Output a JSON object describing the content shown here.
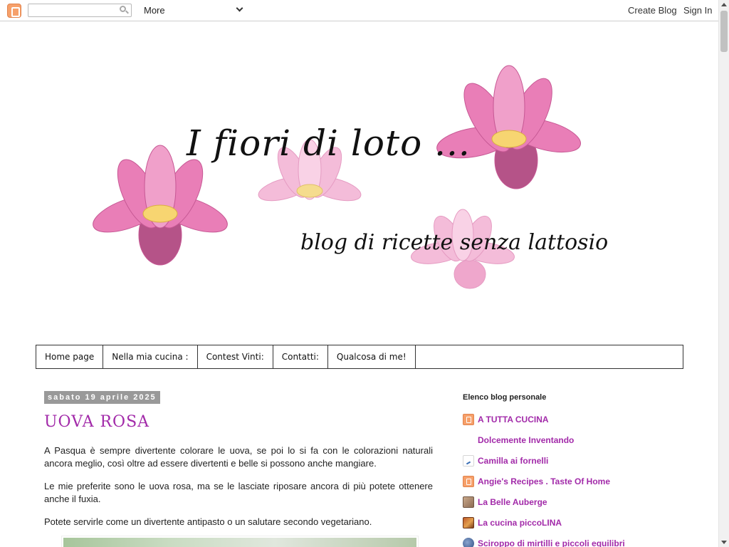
{
  "navbar": {
    "search_placeholder": "",
    "more_label": "More",
    "create_blog": "Create Blog",
    "sign_in": "Sign In"
  },
  "header": {
    "title": "I fiori di loto ...",
    "description": "blog di ricette senza lattosio"
  },
  "tabs": [
    "Home page",
    "Nella mia cucina :",
    "Contest Vinti:",
    "Contatti:",
    "Qualcosa di me!"
  ],
  "post": {
    "date": "sabato 19 aprile 2025",
    "title": "UOVA ROSA",
    "paragraphs": [
      "A Pasqua è sempre divertente colorare le uova, se poi lo si fa con le colorazioni naturali ancora meglio, così oltre ad essere divertenti e belle si possono anche mangiare.",
      "Le mie preferite sono le uova rosa, ma se le lasciate riposare ancora di più potete ottenere anche il fuxia.",
      "Potete servirle come un divertente antipasto o un salutare secondo vegetariano."
    ]
  },
  "sidebar": {
    "title": "Elenco blog personale",
    "blogs": [
      {
        "name": "A TUTTA CUCINA",
        "icon": "blogger-icon"
      },
      {
        "name": "Dolcemente Inventando",
        "icon": "none"
      },
      {
        "name": "Camilla ai fornelli",
        "icon": "file-icon"
      },
      {
        "name": "Angie's Recipes . Taste Of Home",
        "icon": "blogger-icon"
      },
      {
        "name": "La Belle Auberge",
        "icon": "photo-icon"
      },
      {
        "name": "La cucina piccoLINA",
        "icon": "photo-icon"
      },
      {
        "name": "Sciroppo di mirtilli e piccoli equilibri",
        "icon": "globe-icon"
      }
    ]
  },
  "colors": {
    "link": "#a22aa9",
    "date_bg": "#999999",
    "lotus_pink": "#e86fb0"
  }
}
